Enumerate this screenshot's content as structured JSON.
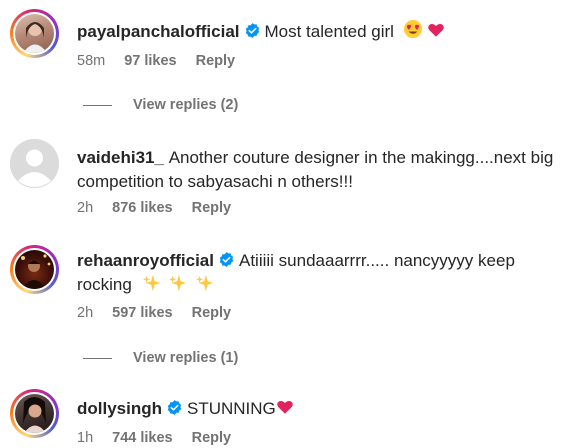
{
  "comments": [
    {
      "username": "payalpanchalofficial",
      "verified": true,
      "text": "Most talented girl",
      "emojis": [
        "heart-eyes",
        "red-heart"
      ],
      "time": "58m",
      "likes": "97 likes",
      "reply": "Reply",
      "view_replies": "View replies (2)"
    },
    {
      "username": "vaidehi31_",
      "verified": false,
      "text": "Another couture designer in the makingg....next big competition to sabyasachi n others!!!",
      "time": "2h",
      "likes": "876 likes",
      "reply": "Reply"
    },
    {
      "username": "rehaanroyofficial",
      "verified": true,
      "text": "Atiiiii sundaaarrrr..... nancyyyyy keep rocking",
      "emojis": [
        "sparkles",
        "sparkles",
        "sparkles"
      ],
      "time": "2h",
      "likes": "597 likes",
      "reply": "Reply",
      "view_replies": "View replies (1)"
    },
    {
      "username": "dollysingh",
      "verified": true,
      "text": "STUNNING",
      "emojis": [
        "red-heart"
      ],
      "time": "1h",
      "likes": "744 likes",
      "reply": "Reply"
    }
  ],
  "colors": {
    "text": "#262626",
    "secondary": "#737373",
    "verified_blue": "#0095f6",
    "heart_red": "#e0245e"
  }
}
